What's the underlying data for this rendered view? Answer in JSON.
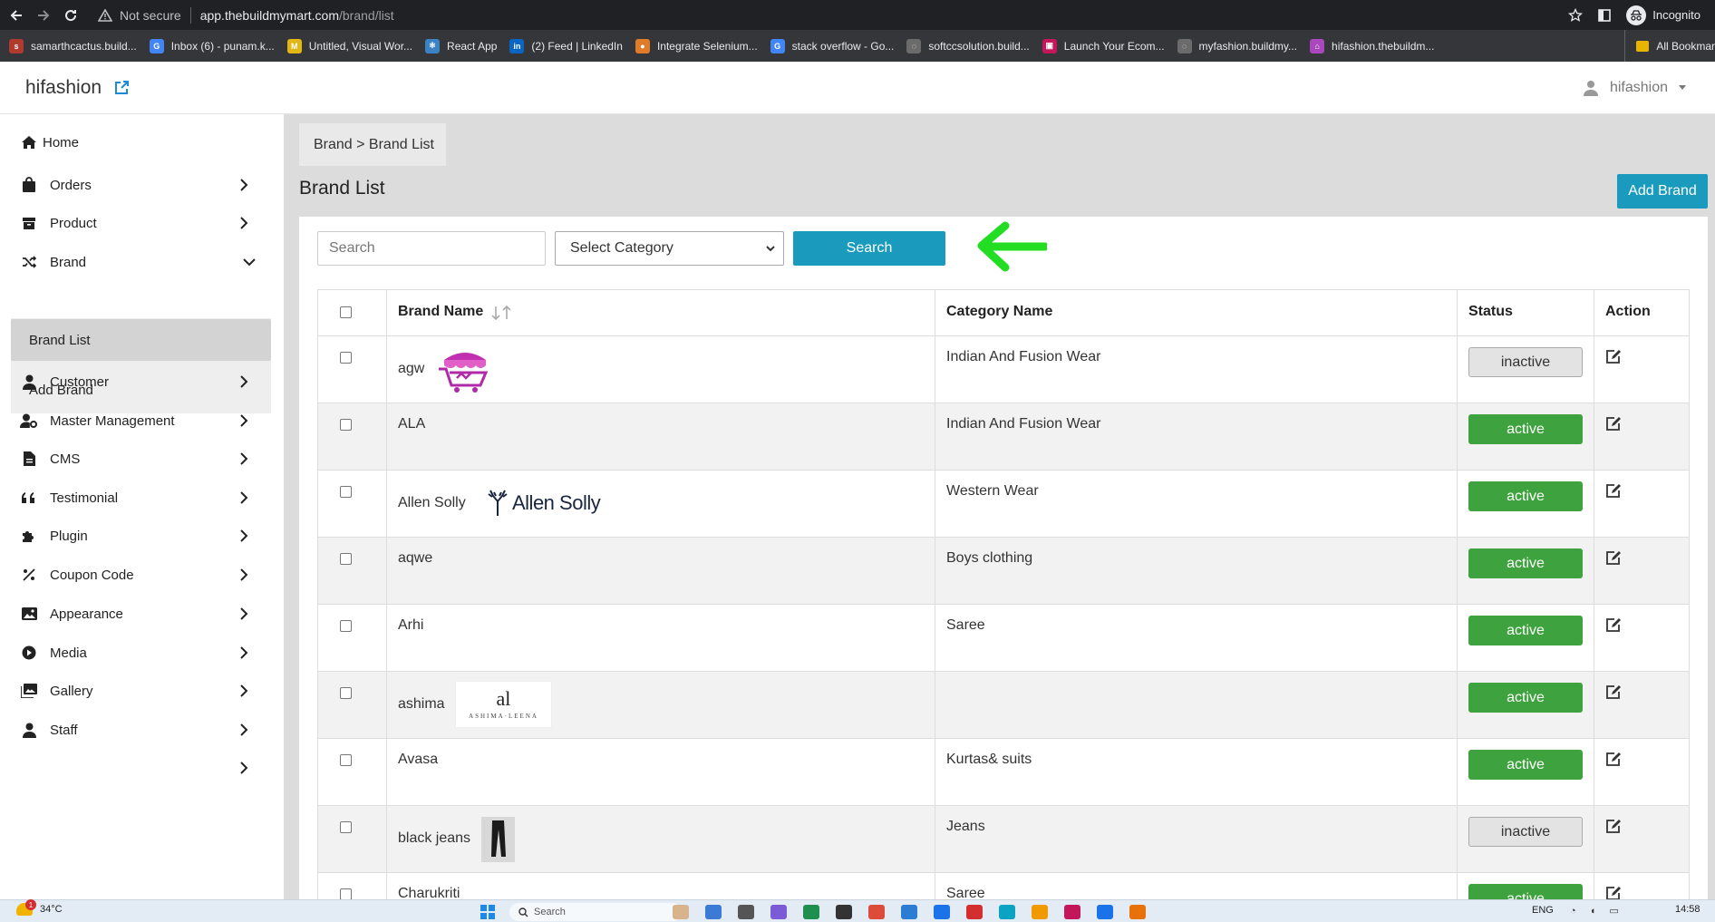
{
  "browser": {
    "security_label": "Not secure",
    "url_host": "app.thebuildmymart.com",
    "url_path": "/brand/list",
    "incognito_label": "Incognito",
    "bookmarks": [
      {
        "label": "samarthcactus.build...",
        "color": "#b03a2e",
        "glyph": "s"
      },
      {
        "label": "Inbox (6) - punam.k...",
        "color": "#4285f4",
        "glyph": "G"
      },
      {
        "label": "Untitled, Visual Wor...",
        "color": "#e2b714",
        "glyph": "M"
      },
      {
        "label": "React App",
        "color": "#3b82c4",
        "glyph": "⚛"
      },
      {
        "label": "(2) Feed | LinkedIn",
        "color": "#0a66c2",
        "glyph": "in"
      },
      {
        "label": "Integrate Selenium...",
        "color": "#e07b2a",
        "glyph": "●"
      },
      {
        "label": "stack overflow - Go...",
        "color": "#4285f4",
        "glyph": "G"
      },
      {
        "label": "softccsolution.build...",
        "color": "#6b6b6b",
        "glyph": "◌"
      },
      {
        "label": "Launch Your Ecom...",
        "color": "#c2185b",
        "glyph": "▣"
      },
      {
        "label": "myfashion.buildmy...",
        "color": "#6b6b6b",
        "glyph": "◌"
      },
      {
        "label": "hifashion.thebuildm...",
        "color": "#ab47bc",
        "glyph": "⌂"
      }
    ],
    "all_bookmarks_label": "All Bookmar"
  },
  "app": {
    "store_name": "hifashion",
    "user_name": "hifashion"
  },
  "sidebar": {
    "items": [
      {
        "label": "Home",
        "icon": "home-icon"
      },
      {
        "label": "Orders",
        "icon": "bag-icon"
      },
      {
        "label": "Product",
        "icon": "product-icon"
      },
      {
        "label": "Brand",
        "icon": "shuffle-icon"
      },
      {
        "label": "Customer",
        "icon": "user-icon"
      },
      {
        "label": "Master Management",
        "icon": "user-cog-icon"
      },
      {
        "label": "CMS",
        "icon": "file-icon"
      },
      {
        "label": "Testimonial",
        "icon": "quote-icon"
      },
      {
        "label": "Plugin",
        "icon": "puzzle-icon"
      },
      {
        "label": "Coupon Code",
        "icon": "percent-icon"
      },
      {
        "label": "Appearance",
        "icon": "image-icon"
      },
      {
        "label": "Media",
        "icon": "play-circle-icon"
      },
      {
        "label": "Gallery",
        "icon": "gallery-icon"
      },
      {
        "label": "Staff",
        "icon": "user-icon"
      }
    ],
    "brand_sub": [
      {
        "label": "Brand List"
      },
      {
        "label": "Add Brand"
      }
    ]
  },
  "breadcrumb": "Brand > Brand List",
  "page_title": "Brand List",
  "add_brand_label": "Add Brand",
  "filters": {
    "search_placeholder": "Search",
    "category_selected": "Select Category",
    "search_button": "Search"
  },
  "table": {
    "headers": {
      "brand_name": "Brand Name",
      "category_name": "Category Name",
      "status": "Status",
      "action": "Action"
    },
    "rows": [
      {
        "brand": "agw",
        "category": "Indian And Fusion Wear",
        "status": "inactive",
        "logo": "cart-logo"
      },
      {
        "brand": "ALA",
        "category": "Indian And Fusion Wear",
        "status": "active",
        "logo": ""
      },
      {
        "brand": "Allen Solly",
        "category": "Western Wear",
        "status": "active",
        "logo": "allen-solly-logo",
        "logo_text": "Allen Solly"
      },
      {
        "brand": "aqwe",
        "category": "Boys clothing",
        "status": "active",
        "logo": ""
      },
      {
        "brand": "Arhi",
        "category": "Saree",
        "status": "active",
        "logo": ""
      },
      {
        "brand": "ashima",
        "category": "",
        "status": "active",
        "logo": "ashima-leena-logo",
        "logo_text": "ASHIMA·LEENA",
        "logo_mark": "al"
      },
      {
        "brand": "Avasa",
        "category": "Kurtas& suits",
        "status": "active",
        "logo": ""
      },
      {
        "brand": "black jeans",
        "category": "Jeans",
        "status": "inactive",
        "logo": "jeans-photo"
      },
      {
        "brand": "Charukriti",
        "category": "Saree",
        "status": "active",
        "logo": ""
      }
    ]
  },
  "taskbar": {
    "weather": "34°C",
    "search_placeholder": "Search",
    "lang": "ENG",
    "time": "14:58",
    "notification_count": "1"
  },
  "colors": {
    "accent": "#1a9bbd",
    "active": "#3ea33e",
    "inactive_bg": "#e3e3e3",
    "annotation_arrow": "#22dd22"
  }
}
